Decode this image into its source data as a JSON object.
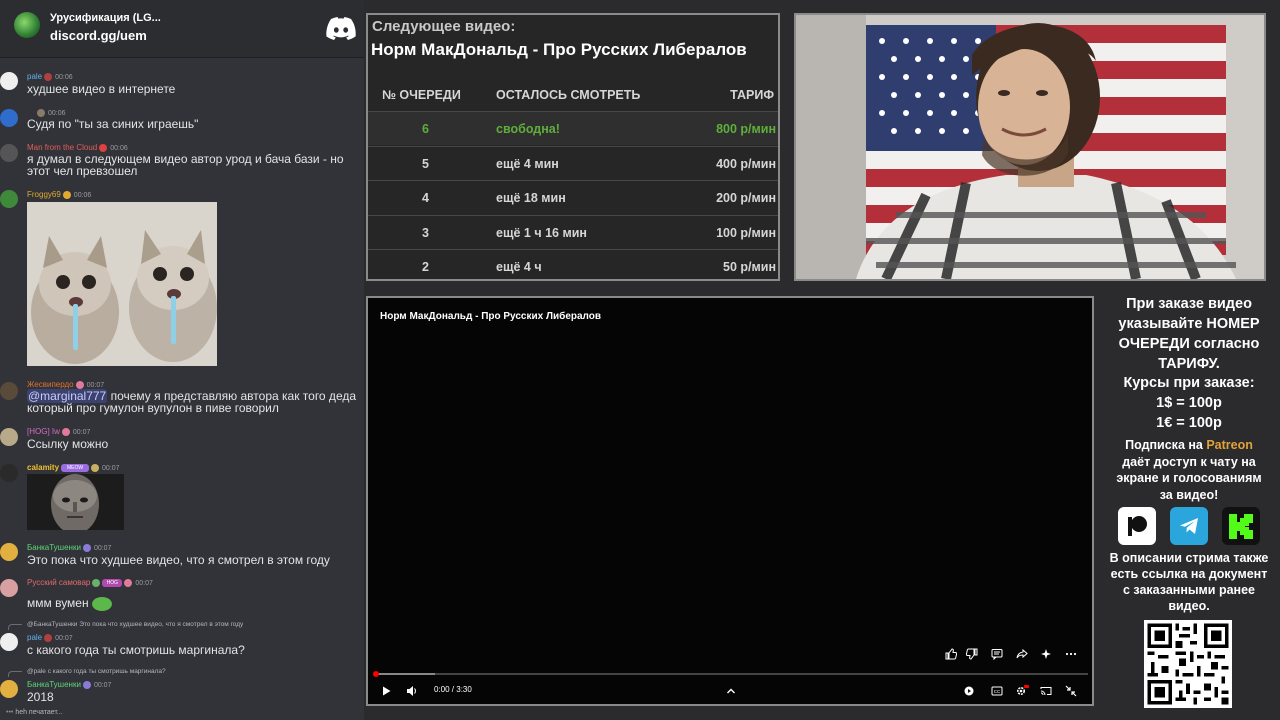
{
  "server": {
    "name": "Урусификация (LG...",
    "invite": "discord.gg/uem"
  },
  "chat": {
    "typing": "heh печатает...",
    "messages": [
      {
        "user": "pale",
        "user_color": "#5eb1e6",
        "time": "00:06",
        "text": "худшее видео в интернете",
        "avatar_color": "#efefef"
      },
      {
        "user": "",
        "user_color": "#e3e4e6",
        "time": "00:06",
        "text": "Судя по \"ты за синих играешь\"",
        "avatar_color": "#2f6ccb"
      },
      {
        "user": "Man from the Cloud",
        "user_color": "#e25c5c",
        "time": "00:06",
        "text": "я думал в следующем видео автор урод и бача бази - но этот чел превзошел",
        "avatar_color": "#555555"
      },
      {
        "user": "Froggy69",
        "user_color": "#e0aa30",
        "time": "00:06",
        "text": "",
        "avatar_color": "#3f8a3a"
      },
      {
        "user": "Жесвипердо",
        "user_color": "#e0722e",
        "time": "00:07",
        "mention": "@marginal777",
        "text": " почему я представляю автора как того деда который про гумулон вупулон в пиве говорил",
        "avatar_color": "#5a4a3a"
      },
      {
        "user": "[HOG] Iw",
        "user_color": "#d96cc3",
        "time": "00:07",
        "text": "Ссылку можно",
        "avatar_color": "#b8a98a"
      },
      {
        "user": "calamity",
        "user_color": "#f0c030",
        "time": "00:07",
        "text": "",
        "avatar_color": "#2a2a2a"
      },
      {
        "user": "БанкаТушенки",
        "user_color": "#5fd37a",
        "time": "00:07",
        "text": "Это пока что худшее видео, что я смотрел в этом году",
        "avatar_color": "#e2b040"
      },
      {
        "user": "Русский самовар",
        "user_color": "#e26b6b",
        "time": "00:07",
        "text": "ммм вумен",
        "avatar_color": "#d8a0a0"
      },
      {
        "reply": "@БанкаТушенки Это пока что худшее видео, что я смотрел в этом году",
        "user": "pale",
        "user_color": "#5eb1e6",
        "time": "00:07",
        "text": "с какого года ты смотришь маргинала?",
        "avatar_color": "#efefef"
      },
      {
        "reply": "@pale с какого года ты смотришь маргинала?",
        "user": "БанкаТушенки",
        "user_color": "#5fd37a",
        "time": "00:07",
        "text": "2018",
        "avatar_color": "#e2b040"
      }
    ],
    "badges": {
      "hog": "HOG",
      "meow": "MEOW"
    }
  },
  "queue": {
    "label": "Следующее видео:",
    "title": "Норм МакДональд - Про Русских Либералов",
    "columns": [
      "№ ОЧЕРЕДИ",
      "ОСТАЛОСЬ СМОТРЕТЬ",
      "ТАРИФ"
    ],
    "rows": [
      {
        "num": "6",
        "remaining": "свободна!",
        "rate": "800 р/мин"
      },
      {
        "num": "5",
        "remaining": "ещё 4 мин",
        "rate": "400 р/мин"
      },
      {
        "num": "4",
        "remaining": "ещё 18 мин",
        "rate": "200 р/мин"
      },
      {
        "num": "3",
        "remaining": "ещё 1 ч 16 мин",
        "rate": "100 р/мин"
      },
      {
        "num": "2",
        "remaining": "ещё 4 ч",
        "rate": "50 р/мин"
      }
    ],
    "accent": "#5fae3c"
  },
  "player": {
    "title": "Норм МакДональд - Про Русских Либералов",
    "time": "0:00 / 3:30",
    "progress_fraction": 0.0,
    "buffer_fraction": 0.085,
    "accent": "#ff0000"
  },
  "info": {
    "order_lines": [
      "При заказе видео",
      "указывайте НОМЕР",
      "ОЧЕРЕДИ согласно",
      "ТАРИФУ."
    ],
    "rates_lines": [
      "Курсы при заказе:",
      "1$ = 100р",
      "1€ = 100р"
    ],
    "sub_prefix": "Подписка на ",
    "sub_patreon": "Patreon",
    "sub_lines": [
      "даёт доступ к чату на",
      "экране и голосованиям",
      "за видео!"
    ],
    "desc_lines": [
      "В описании стрима также",
      "есть ссылка на документ",
      "с заказанными ранее",
      "видео."
    ],
    "social_icons": [
      "patreon-icon",
      "telegram-icon",
      "kick-icon"
    ]
  }
}
